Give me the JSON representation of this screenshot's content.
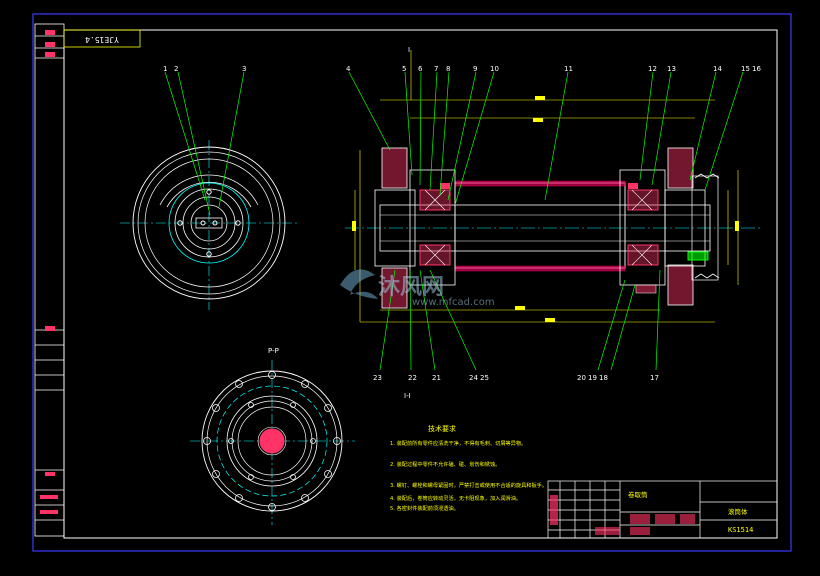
{
  "drawing": {
    "title_block_code": "YJE15.4",
    "view_label": "P-P",
    "section_label": "I-I",
    "detail_mark": "I",
    "balloons": [
      "1",
      "2",
      "3",
      "4",
      "5",
      "6",
      "7",
      "8",
      "9",
      "10",
      "11",
      "12",
      "13",
      "14",
      "15",
      "16",
      "17",
      "18",
      "19",
      "20",
      "21",
      "22",
      "23",
      "24",
      "25"
    ],
    "notes_title": "技术要求",
    "notes": [
      "1. 装配前所有零件应清洗干净，不得有毛刺、切屑等异物。",
      "2. 装配过程中零件不允许磕、碰、划伤和锈蚀。",
      "3. 螺钉、螺栓和螺母紧固时，严禁打击或使用不合适的旋具和扳手。",
      "4. 装配后，卷筒应转动灵活，无卡阻现象，加入润滑油。",
      "5. 各密封件装配前须浸透油。"
    ],
    "title_block": {
      "name": "卷取筒",
      "unit": "滚筒体",
      "code": "KS1514"
    },
    "watermark": {
      "brand_cn": "沐风网",
      "url": "www.mfcad.com"
    }
  },
  "colors": {
    "background": "#000000",
    "frame": "#0000ff",
    "outline": "#ffffff",
    "leader": "#00ff00",
    "center": "#00ffff",
    "section": "#ff0066",
    "dimension": "#ffff00",
    "part": "#ff3366"
  }
}
